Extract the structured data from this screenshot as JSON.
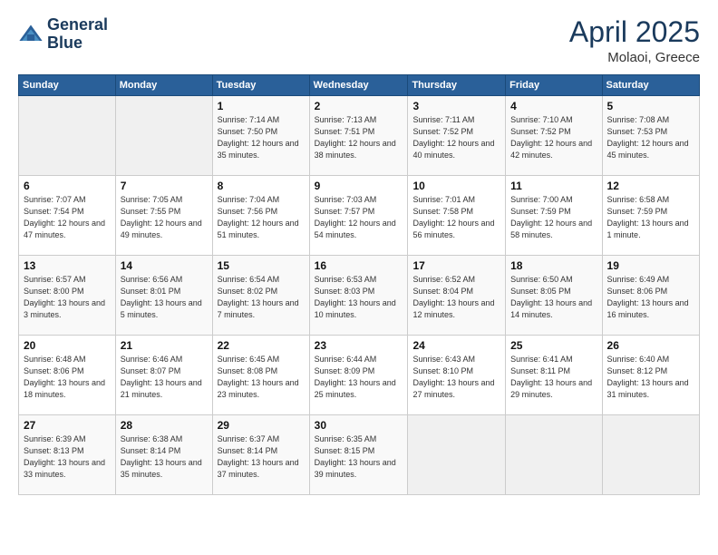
{
  "logo": {
    "line1": "General",
    "line2": "Blue"
  },
  "title": {
    "month_year": "April 2025",
    "location": "Molaoi, Greece"
  },
  "days_of_week": [
    "Sunday",
    "Monday",
    "Tuesday",
    "Wednesday",
    "Thursday",
    "Friday",
    "Saturday"
  ],
  "weeks": [
    [
      {
        "day": "",
        "info": ""
      },
      {
        "day": "",
        "info": ""
      },
      {
        "day": "1",
        "info": "Sunrise: 7:14 AM\nSunset: 7:50 PM\nDaylight: 12 hours and 35 minutes."
      },
      {
        "day": "2",
        "info": "Sunrise: 7:13 AM\nSunset: 7:51 PM\nDaylight: 12 hours and 38 minutes."
      },
      {
        "day": "3",
        "info": "Sunrise: 7:11 AM\nSunset: 7:52 PM\nDaylight: 12 hours and 40 minutes."
      },
      {
        "day": "4",
        "info": "Sunrise: 7:10 AM\nSunset: 7:52 PM\nDaylight: 12 hours and 42 minutes."
      },
      {
        "day": "5",
        "info": "Sunrise: 7:08 AM\nSunset: 7:53 PM\nDaylight: 12 hours and 45 minutes."
      }
    ],
    [
      {
        "day": "6",
        "info": "Sunrise: 7:07 AM\nSunset: 7:54 PM\nDaylight: 12 hours and 47 minutes."
      },
      {
        "day": "7",
        "info": "Sunrise: 7:05 AM\nSunset: 7:55 PM\nDaylight: 12 hours and 49 minutes."
      },
      {
        "day": "8",
        "info": "Sunrise: 7:04 AM\nSunset: 7:56 PM\nDaylight: 12 hours and 51 minutes."
      },
      {
        "day": "9",
        "info": "Sunrise: 7:03 AM\nSunset: 7:57 PM\nDaylight: 12 hours and 54 minutes."
      },
      {
        "day": "10",
        "info": "Sunrise: 7:01 AM\nSunset: 7:58 PM\nDaylight: 12 hours and 56 minutes."
      },
      {
        "day": "11",
        "info": "Sunrise: 7:00 AM\nSunset: 7:59 PM\nDaylight: 12 hours and 58 minutes."
      },
      {
        "day": "12",
        "info": "Sunrise: 6:58 AM\nSunset: 7:59 PM\nDaylight: 13 hours and 1 minute."
      }
    ],
    [
      {
        "day": "13",
        "info": "Sunrise: 6:57 AM\nSunset: 8:00 PM\nDaylight: 13 hours and 3 minutes."
      },
      {
        "day": "14",
        "info": "Sunrise: 6:56 AM\nSunset: 8:01 PM\nDaylight: 13 hours and 5 minutes."
      },
      {
        "day": "15",
        "info": "Sunrise: 6:54 AM\nSunset: 8:02 PM\nDaylight: 13 hours and 7 minutes."
      },
      {
        "day": "16",
        "info": "Sunrise: 6:53 AM\nSunset: 8:03 PM\nDaylight: 13 hours and 10 minutes."
      },
      {
        "day": "17",
        "info": "Sunrise: 6:52 AM\nSunset: 8:04 PM\nDaylight: 13 hours and 12 minutes."
      },
      {
        "day": "18",
        "info": "Sunrise: 6:50 AM\nSunset: 8:05 PM\nDaylight: 13 hours and 14 minutes."
      },
      {
        "day": "19",
        "info": "Sunrise: 6:49 AM\nSunset: 8:06 PM\nDaylight: 13 hours and 16 minutes."
      }
    ],
    [
      {
        "day": "20",
        "info": "Sunrise: 6:48 AM\nSunset: 8:06 PM\nDaylight: 13 hours and 18 minutes."
      },
      {
        "day": "21",
        "info": "Sunrise: 6:46 AM\nSunset: 8:07 PM\nDaylight: 13 hours and 21 minutes."
      },
      {
        "day": "22",
        "info": "Sunrise: 6:45 AM\nSunset: 8:08 PM\nDaylight: 13 hours and 23 minutes."
      },
      {
        "day": "23",
        "info": "Sunrise: 6:44 AM\nSunset: 8:09 PM\nDaylight: 13 hours and 25 minutes."
      },
      {
        "day": "24",
        "info": "Sunrise: 6:43 AM\nSunset: 8:10 PM\nDaylight: 13 hours and 27 minutes."
      },
      {
        "day": "25",
        "info": "Sunrise: 6:41 AM\nSunset: 8:11 PM\nDaylight: 13 hours and 29 minutes."
      },
      {
        "day": "26",
        "info": "Sunrise: 6:40 AM\nSunset: 8:12 PM\nDaylight: 13 hours and 31 minutes."
      }
    ],
    [
      {
        "day": "27",
        "info": "Sunrise: 6:39 AM\nSunset: 8:13 PM\nDaylight: 13 hours and 33 minutes."
      },
      {
        "day": "28",
        "info": "Sunrise: 6:38 AM\nSunset: 8:14 PM\nDaylight: 13 hours and 35 minutes."
      },
      {
        "day": "29",
        "info": "Sunrise: 6:37 AM\nSunset: 8:14 PM\nDaylight: 13 hours and 37 minutes."
      },
      {
        "day": "30",
        "info": "Sunrise: 6:35 AM\nSunset: 8:15 PM\nDaylight: 13 hours and 39 minutes."
      },
      {
        "day": "",
        "info": ""
      },
      {
        "day": "",
        "info": ""
      },
      {
        "day": "",
        "info": ""
      }
    ]
  ]
}
